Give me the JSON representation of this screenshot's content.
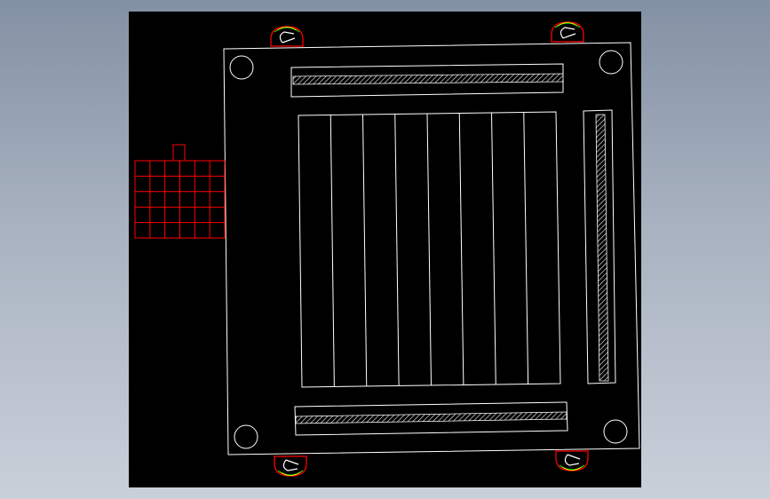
{
  "viewport": {
    "background_gradient": [
      "#8391a4",
      "#a8b2c0",
      "#c9d0da"
    ],
    "drawing_background": "#000000"
  },
  "colors": {
    "outline": "#ffffff",
    "accent": "#ff0000",
    "hatch": "#ffffff",
    "marker_green": "#00ff00",
    "marker_yellow": "#ffff00"
  },
  "drawing": {
    "type": "cad-top-view",
    "mounting_holes": 4,
    "clamp_hooks": 4,
    "slat_columns": 8,
    "hatched_bars": 3,
    "connector_grid": {
      "rows": 5,
      "cols": 6
    }
  }
}
